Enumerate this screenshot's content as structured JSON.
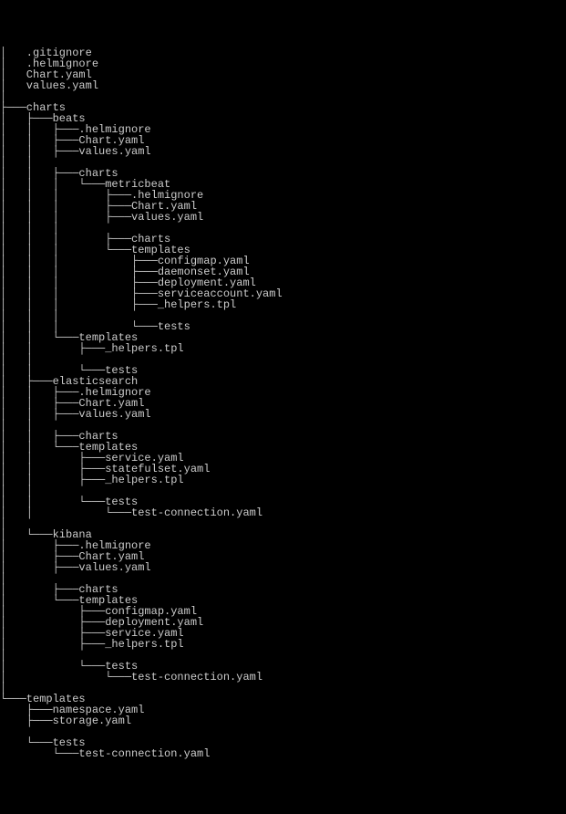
{
  "tree": {
    "children": [
      {
        "name": ".gitignore"
      },
      {
        "name": ".helmignore"
      },
      {
        "name": "Chart.yaml"
      },
      {
        "name": "values.yaml"
      },
      {
        "spacer": true
      },
      {
        "name": "charts",
        "children": [
          {
            "name": "beats",
            "children": [
              {
                "name": ".helmignore"
              },
              {
                "name": "Chart.yaml"
              },
              {
                "name": "values.yaml"
              },
              {
                "spacer": true
              },
              {
                "name": "charts",
                "children": [
                  {
                    "name": "metricbeat",
                    "children": [
                      {
                        "name": ".helmignore"
                      },
                      {
                        "name": "Chart.yaml"
                      },
                      {
                        "name": "values.yaml"
                      },
                      {
                        "spacer": true
                      },
                      {
                        "name": "charts"
                      },
                      {
                        "name": "templates",
                        "children": [
                          {
                            "name": "configmap.yaml"
                          },
                          {
                            "name": "daemonset.yaml"
                          },
                          {
                            "name": "deployment.yaml"
                          },
                          {
                            "name": "serviceaccount.yaml"
                          },
                          {
                            "name": "_helpers.tpl"
                          },
                          {
                            "spacer": true
                          },
                          {
                            "name": "tests"
                          }
                        ]
                      }
                    ]
                  }
                ]
              },
              {
                "name": "templates",
                "children": [
                  {
                    "name": "_helpers.tpl"
                  },
                  {
                    "spacer": true
                  },
                  {
                    "name": "tests"
                  }
                ]
              }
            ]
          },
          {
            "name": "elasticsearch",
            "children": [
              {
                "name": ".helmignore"
              },
              {
                "name": "Chart.yaml"
              },
              {
                "name": "values.yaml"
              },
              {
                "spacer": true
              },
              {
                "name": "charts"
              },
              {
                "name": "templates",
                "children": [
                  {
                    "name": "service.yaml"
                  },
                  {
                    "name": "statefulset.yaml"
                  },
                  {
                    "name": "_helpers.tpl"
                  },
                  {
                    "spacer": true
                  },
                  {
                    "name": "tests",
                    "children": [
                      {
                        "name": "test-connection.yaml"
                      }
                    ]
                  }
                ]
              }
            ]
          },
          {
            "spacer": true
          },
          {
            "name": "kibana",
            "children": [
              {
                "name": ".helmignore"
              },
              {
                "name": "Chart.yaml"
              },
              {
                "name": "values.yaml"
              },
              {
                "spacer": true
              },
              {
                "name": "charts"
              },
              {
                "name": "templates",
                "children": [
                  {
                    "name": "configmap.yaml"
                  },
                  {
                    "name": "deployment.yaml"
                  },
                  {
                    "name": "service.yaml"
                  },
                  {
                    "name": "_helpers.tpl"
                  },
                  {
                    "spacer": true
                  },
                  {
                    "name": "tests",
                    "children": [
                      {
                        "name": "test-connection.yaml"
                      }
                    ]
                  }
                ]
              }
            ]
          }
        ]
      },
      {
        "spacer": true
      },
      {
        "name": "templates",
        "children": [
          {
            "name": "namespace.yaml"
          },
          {
            "name": "storage.yaml"
          },
          {
            "spacer": true
          },
          {
            "name": "tests",
            "children": [
              {
                "name": "test-connection.yaml"
              }
            ]
          }
        ]
      }
    ]
  }
}
